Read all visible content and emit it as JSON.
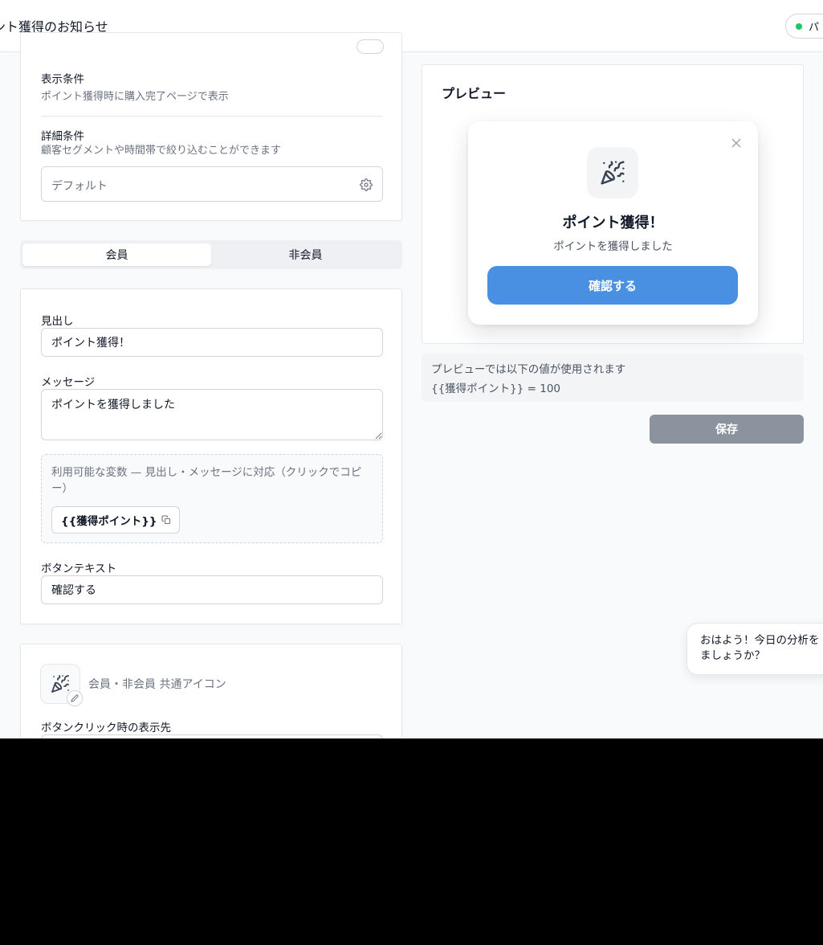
{
  "header": {
    "title": "ント獲得のお知らせ",
    "status_label": "パ"
  },
  "settings": {
    "display_condition_label": "表示条件",
    "display_condition_value": "ポイント獲得時に購入完了ページで表示",
    "detail_condition_label": "詳細条件",
    "detail_condition_help": "顧客セグメントや時間帯で絞り込むことができます",
    "detail_condition_select": "デフォルト"
  },
  "tabs": [
    {
      "label": "会員",
      "active": true
    },
    {
      "label": "非会員",
      "active": false
    }
  ],
  "content": {
    "heading_label": "見出し",
    "heading_value": "ポイント獲得！",
    "message_label": "メッセージ",
    "message_value": "ポイントを獲得しました",
    "variables_desc": "利用可能な変数 — 見出し・メッセージに対応（クリックでコピー）",
    "variable_chip": "{{獲得ポイント}}",
    "button_text_label": "ボタンテキスト",
    "button_text_value": "確認する"
  },
  "icon_section": {
    "icon_caption": "会員・非会員 共通アイコン",
    "click_target_label": "ボタンクリック時の表示先"
  },
  "preview": {
    "title": "プレビュー",
    "modal_heading": "ポイント獲得！",
    "modal_message": "ポイントを獲得しました",
    "modal_button": "確認する",
    "note_line1": "プレビューでは以下の値が使用されます",
    "note_line2": "{{獲得ポイント}} = 100"
  },
  "save_label": "保存",
  "chat": {
    "message": "おはよう！今日の分析を​ましょうか？"
  },
  "colors": {
    "primary": "#4a90e2",
    "save_disabled": "#8b949e",
    "status_dot": "#22c55e"
  },
  "icons": [
    "party-popper-icon",
    "gear-icon",
    "copy-icon",
    "close-icon",
    "pencil-icon"
  ]
}
